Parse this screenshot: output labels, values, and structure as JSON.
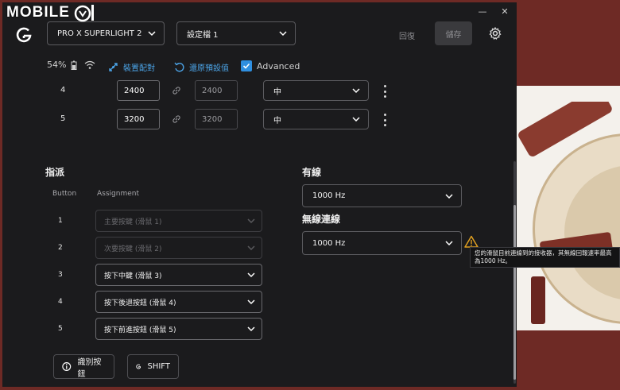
{
  "watermark": {
    "text": "MOBILE"
  },
  "window": {
    "minimize": "—",
    "close": "✕"
  },
  "header": {
    "device_select": "PRO X SUPERLIGHT 2",
    "profile_select": "設定檔 1",
    "undo_label": "回復",
    "save_label": "儲存"
  },
  "status": {
    "battery": "54%",
    "pair_label": "裝置配對",
    "reset_label": "還原預設值",
    "advanced_label": "Advanced",
    "advanced_checked": true
  },
  "dpi_rows": [
    {
      "index": "4",
      "x": "2400",
      "y": "2400",
      "level": "中"
    },
    {
      "index": "5",
      "x": "3200",
      "y": "3200",
      "level": "中"
    }
  ],
  "assignment": {
    "title": "指派",
    "col_button": "Button",
    "col_assignment": "Assignment",
    "rows": [
      {
        "num": "1",
        "label": "主要按鍵 (滑鼠 1)",
        "disabled": true
      },
      {
        "num": "2",
        "label": "次要按鍵 (滑鼠 2)",
        "disabled": true
      },
      {
        "num": "3",
        "label": "按下中鍵 (滑鼠 3)",
        "disabled": false
      },
      {
        "num": "4",
        "label": "按下後退按鈕 (滑鼠 4)",
        "disabled": false
      },
      {
        "num": "5",
        "label": "按下前進按鈕 (滑鼠 5)",
        "disabled": false
      }
    ],
    "identify_label": "識別按鈕",
    "shift_label": "SHIFT"
  },
  "report_rate": {
    "wired_title": "有線",
    "wired_value": "1000 Hz",
    "wireless_title": "無線連線",
    "wireless_value": "1000 Hz",
    "tooltip": "您的滑鼠目前連線到的接收器，其無線回報速率最高為1000 Hz。"
  },
  "colors": {
    "accent": "#2f8fe0",
    "link": "#4ba3e6",
    "warning": "#e0a020",
    "panel": "#1b1b1d"
  }
}
